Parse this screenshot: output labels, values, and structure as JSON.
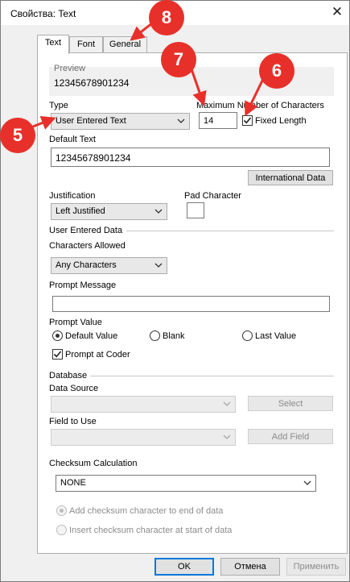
{
  "window": {
    "title": "Свойства: Text"
  },
  "tabs": [
    {
      "label": "Text"
    },
    {
      "label": "Font"
    },
    {
      "label": "General"
    }
  ],
  "preview": {
    "label": "Preview",
    "value": "12345678901234"
  },
  "type": {
    "label": "Type",
    "value": "User Entered Text"
  },
  "max_chars": {
    "label": "Maximum Number of Characters",
    "value": "14"
  },
  "fixed_length": {
    "label": "Fixed Length",
    "checked": true
  },
  "default_text": {
    "label": "Default Text",
    "value": "12345678901234"
  },
  "international_button": "International Data",
  "justification": {
    "label": "Justification",
    "value": "Left Justified"
  },
  "pad_character": {
    "label": "Pad Character",
    "value": ""
  },
  "user_entered_data": {
    "section_label": "User Entered Data",
    "chars_allowed_label": "Characters Allowed",
    "chars_allowed_value": "Any Characters",
    "prompt_message_label": "Prompt Message",
    "prompt_message_value": "",
    "prompt_value_label": "Prompt Value",
    "options": [
      "Default Value",
      "Blank",
      "Last Value"
    ],
    "selected": "Default Value",
    "prompt_at_coder": {
      "label": "Prompt at Coder",
      "checked": true
    }
  },
  "database": {
    "section_label": "Database",
    "data_source_label": "Data Source",
    "select_button": "Select",
    "field_label": "Field to Use",
    "add_field_button": "Add Field"
  },
  "checksum": {
    "label": "Checksum Calculation",
    "value": "NONE",
    "options": [
      "Add checksum character to end of data",
      "Insert checksum character at start of data"
    ],
    "selected": "Add checksum character to end of data"
  },
  "footer": {
    "ok": "OK",
    "cancel": "Отмена",
    "apply": "Применить"
  },
  "callouts": [
    "5",
    "6",
    "7",
    "8"
  ],
  "colors": {
    "callout": "#e8302a",
    "focus": "#0078d7"
  }
}
